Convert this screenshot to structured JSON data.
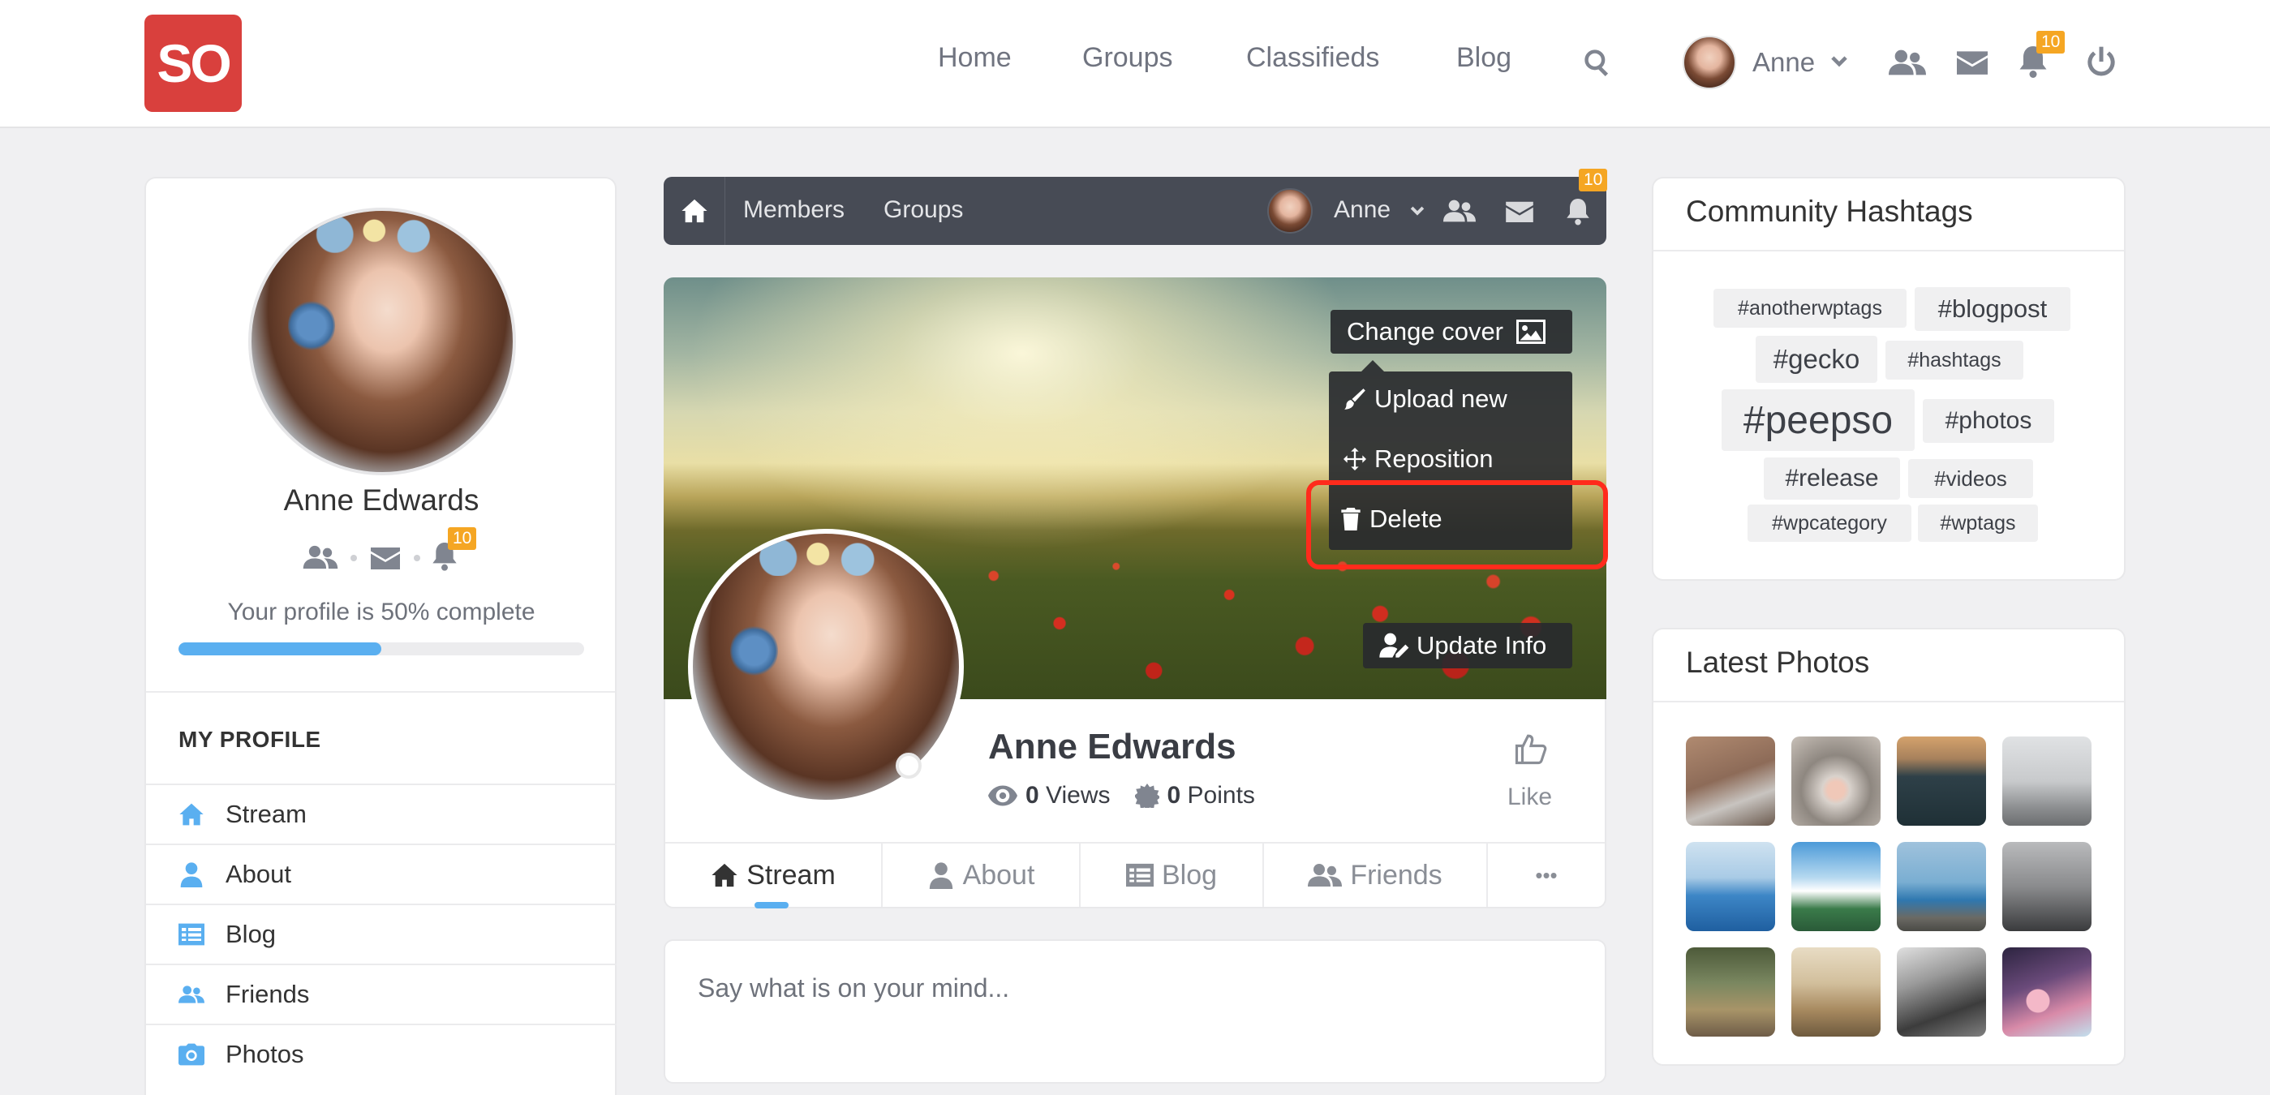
{
  "brand": {
    "logo_text": "SO",
    "accent": "#d9403d"
  },
  "topnav": {
    "links": [
      "Home",
      "Groups",
      "Classifieds",
      "Blog"
    ],
    "user_name": "Anne",
    "notifications_count": "10"
  },
  "left": {
    "name": "Anne Edwards",
    "notifications_count": "10",
    "progress_text": "Your profile is 50% complete",
    "progress_fraction": 0.5,
    "section_title": "MY PROFILE",
    "menu": [
      {
        "label": "Stream",
        "icon": "home-icon"
      },
      {
        "label": "About",
        "icon": "user-icon"
      },
      {
        "label": "Blog",
        "icon": "list-icon"
      },
      {
        "label": "Friends",
        "icon": "friends-icon"
      },
      {
        "label": "Photos",
        "icon": "camera-icon"
      }
    ]
  },
  "subnav": {
    "links": [
      "Members",
      "Groups"
    ],
    "user_name": "Anne",
    "notifications_count": "10"
  },
  "cover": {
    "change_cover": "Change cover",
    "menu": [
      "Upload new",
      "Reposition",
      "Delete"
    ],
    "update_info": "Update Info"
  },
  "profile": {
    "name": "Anne Edwards",
    "views_count": "0",
    "views_label": "Views",
    "points_count": "0",
    "points_label": "Points",
    "like_label": "Like",
    "tabs": [
      "Stream",
      "About",
      "Blog",
      "Friends"
    ],
    "more": "•••"
  },
  "composer": {
    "placeholder": "Say what is on your mind..."
  },
  "hashtags": {
    "title": "Community Hashtags",
    "tags": [
      "#anotherwptags",
      "#blogpost",
      "#gecko",
      "#hashtags",
      "#peepso",
      "#photos",
      "#release",
      "#videos",
      "#wpcategory",
      "#wptags"
    ]
  },
  "photos": {
    "title": "Latest Photos"
  }
}
